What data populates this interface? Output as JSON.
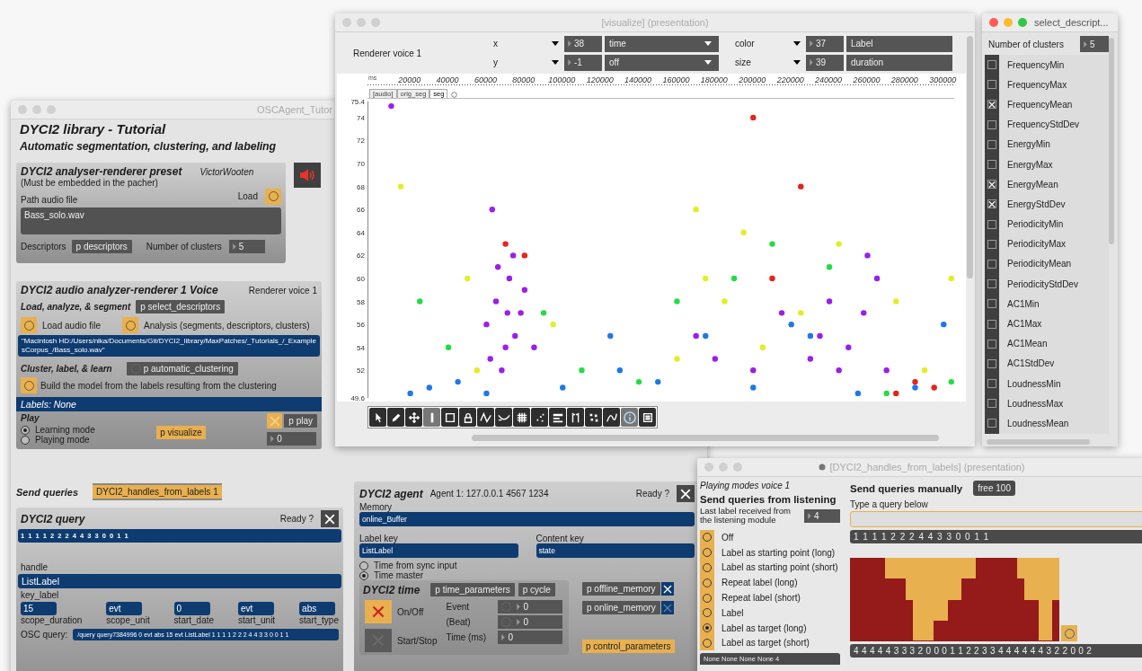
{
  "osc_window": {
    "title": "OSCAgent_Tutor",
    "heading": "DYCI2 library - Tutorial",
    "subheading": "Automatic segmentation, clustering, and labeling",
    "preset": {
      "title": "DYCI2 analyser-renderer preset",
      "name": "VictorWooten",
      "note": "(Must be embedded in the pacher)",
      "load_label": "Load",
      "path_label": "Path audio file",
      "path_value": "Bass_solo.wav",
      "descriptors_label": "Descriptors",
      "descriptors_button": "p descriptors",
      "clusters_label": "Number of clusters",
      "clusters_value": "5"
    },
    "voice": {
      "title": "DYCI2 audio analyzer-renderer 1 Voice",
      "renderer": "Renderer voice 1",
      "segment_label": "Load, analyze, & segment",
      "select_button": "p select_descriptors",
      "load_audio": "Load audio file",
      "analysis": "Analysis (segments, descriptors, clusters)",
      "path": "\"Macintosh HD:/Users/nika/Documents/Git/DYCI2_library/MaxPatches/_Tutorials_/_ExamplesCorpus_/Bass_solo.wav\"",
      "cluster_label": "Cluster, label, & learn",
      "clustering_button": "p automatic_clustering",
      "build_model": "Build the model from the labels resulting from the clustering",
      "labels": "Labels: None",
      "play_label": "Play",
      "modes": [
        {
          "label": "Learning mode",
          "selected": true
        },
        {
          "label": "Playing mode",
          "selected": false
        }
      ],
      "visualize_button": "p visualize",
      "play_toggle_on": false,
      "play_button": "p play",
      "play_value": "0"
    },
    "send_queries": {
      "label": "Send queries",
      "button": "DYCI2_handles_from_labels 1"
    },
    "query": {
      "title": "DYCI2 query",
      "ready": "Ready ?",
      "sequence": "1 1 1 1 2 2 2 4 4 3 3 0 0 1 1",
      "handle_label": "handle",
      "handle_value": "ListLabel",
      "key_label": "key_label",
      "params": [
        {
          "value": "15",
          "label": "scope_duration"
        },
        {
          "value": "evt",
          "label": "scope_unit"
        },
        {
          "value": "0",
          "label": "start_date"
        },
        {
          "value": "evt",
          "label": "start_unit"
        },
        {
          "value": "abs",
          "label": "start_type"
        }
      ],
      "osc_label": "OSC query:",
      "osc_value": "/query query7384996 0 evt abs 15 evt ListLabel 1 1 1 1 2 2 2 4 4 3 3 0 0 1 1"
    },
    "agent": {
      "title": "DYCI2 agent",
      "info": "Agent 1: 127.0.0.1 4567 1234",
      "ready": "Ready ?",
      "memory_label": "Memory",
      "memory_value": "online_Buffer",
      "label_key_label": "Label key",
      "label_key_value": "ListLabel",
      "content_key_label": "Content key",
      "content_key_value": "state",
      "time_modes": [
        {
          "label": "Time from sync input",
          "selected": false
        },
        {
          "label": "Time master",
          "selected": true
        }
      ],
      "time_title": "DYCI2 time",
      "time_params_button": "p time_parameters",
      "cycle_button": "p cycle",
      "toggles": [
        {
          "label": "On/Off",
          "checked": true
        },
        {
          "label": "Start/Stop",
          "checked": false
        }
      ],
      "counters": [
        {
          "label": "Event",
          "value": "0",
          "kind": "bang"
        },
        {
          "label": "(Beat)",
          "value": "0",
          "kind": "bang"
        },
        {
          "label": "Time (ms)",
          "value": "0",
          "kind": "plain"
        }
      ],
      "memories": [
        {
          "label": "p offline_memory",
          "checked": true
        },
        {
          "label": "p online_memory",
          "checked": false
        }
      ],
      "control_button": "p control_parameters"
    }
  },
  "visualize": {
    "title": "[visualize] (presentation)",
    "renderer": "Renderer voice 1",
    "mappings": [
      {
        "axis": "x",
        "number": "38",
        "field": "time"
      },
      {
        "axis": "y",
        "number": "-1",
        "field": "off"
      },
      {
        "axis": "color",
        "number": "37",
        "field": "Label"
      },
      {
        "axis": "size",
        "number": "39",
        "field": "duration"
      }
    ],
    "tabs": [
      {
        "label": "[audio]",
        "selected": false
      },
      {
        "label": "orig_seg",
        "selected": false
      },
      {
        "label": "seg",
        "selected": true
      }
    ],
    "chart_data": {
      "type": "scatter",
      "xlabel": "ms",
      "xlim": [
        -2000,
        306000
      ],
      "ylim": [
        49.6,
        75.4
      ],
      "xticks": [
        {
          "value": 20000,
          "label": "20000"
        },
        {
          "value": 40000,
          "label": "40000"
        },
        {
          "value": 60000,
          "label": "60000"
        },
        {
          "value": 80000,
          "label": "80000"
        },
        {
          "value": 100000,
          "label": "100000"
        },
        {
          "value": 120000,
          "label": "120000"
        },
        {
          "value": 140000,
          "label": "140000"
        },
        {
          "value": 160000,
          "label": "160000"
        },
        {
          "value": 180000,
          "label": "180000"
        },
        {
          "value": 200000,
          "label": "200000"
        },
        {
          "value": 220000,
          "label": "220000"
        },
        {
          "value": 240000,
          "label": "240000"
        },
        {
          "value": 260000,
          "label": "260000"
        },
        {
          "value": 280000,
          "label": "280000"
        },
        {
          "value": 300000,
          "label": "300000"
        }
      ],
      "yticks": [
        {
          "value": 75.4,
          "label": "75.4"
        },
        {
          "value": 74,
          "label": "74"
        },
        {
          "value": 72,
          "label": "72"
        },
        {
          "value": 70,
          "label": "70"
        },
        {
          "value": 68,
          "label": "68"
        },
        {
          "value": 66,
          "label": "66"
        },
        {
          "value": 64,
          "label": "64"
        },
        {
          "value": 62,
          "label": "62"
        },
        {
          "value": 60,
          "label": "60"
        },
        {
          "value": 58,
          "label": "58"
        },
        {
          "value": 56,
          "label": "56"
        },
        {
          "value": 54,
          "label": "54"
        },
        {
          "value": 52,
          "label": "52"
        },
        {
          "value": 49.6,
          "label": "49.6"
        }
      ],
      "series": [
        {
          "color": "#9b1fe8",
          "x": [
            60000,
            65000,
            70000,
            72000,
            75000,
            78000,
            68000,
            62000,
            80000,
            74000,
            85000,
            63000,
            235000,
            240000,
            250000,
            258000,
            265000,
            270000,
            230000,
            245000,
            180000,
            170000,
            215000,
            10000,
            260000,
            200000,
            66000,
            71000
          ],
          "values": [
            56,
            58,
            54,
            60,
            55,
            57,
            52,
            53,
            59,
            62,
            54,
            66,
            55,
            58,
            54,
            57,
            60,
            52,
            53,
            52,
            53,
            55,
            57,
            75,
            62,
            52,
            61,
            57
          ]
        },
        {
          "color": "#1e78e6",
          "x": [
            20000,
            30000,
            45000,
            60000,
            100000,
            130000,
            150000,
            175000,
            200000,
            230000,
            255000,
            285000,
            300000,
            125000,
            220000
          ],
          "values": [
            50,
            50.5,
            51,
            50,
            50.5,
            52,
            51,
            55,
            50.5,
            55,
            50,
            50.5,
            56,
            55,
            56
          ]
        },
        {
          "color": "#22dd44",
          "x": [
            25000,
            40000,
            90000,
            110000,
            160000,
            190000,
            210000,
            240000,
            270000,
            304000,
            140000
          ],
          "values": [
            58,
            54,
            57,
            52,
            58,
            60,
            63,
            61,
            50,
            51,
            51
          ]
        },
        {
          "color": "#e2ee22",
          "x": [
            15000,
            50000,
            55000,
            95000,
            170000,
            175000,
            185000,
            195000,
            205000,
            225000,
            245000,
            275000,
            290000,
            304000,
            160000
          ],
          "values": [
            68,
            60,
            52,
            56,
            66,
            60,
            58,
            64,
            54,
            57,
            63,
            58,
            52,
            60,
            53
          ]
        },
        {
          "color": "#e6231c",
          "x": [
            70000,
            80000,
            210000,
            225000,
            275000,
            285000,
            295000,
            200000
          ],
          "values": [
            63,
            62,
            60,
            68,
            50,
            51,
            50.5,
            74
          ]
        }
      ]
    }
  },
  "descriptors": {
    "title": "select_descript...",
    "clusters_label": "Number of clusters",
    "clusters_value": "5",
    "items": [
      {
        "label": "FrequencyMin",
        "checked": false
      },
      {
        "label": "FrequencyMax",
        "checked": false
      },
      {
        "label": "FrequencyMean",
        "checked": true
      },
      {
        "label": "FrequencyStdDev",
        "checked": false
      },
      {
        "label": "EnergyMin",
        "checked": false
      },
      {
        "label": "EnergyMax",
        "checked": false
      },
      {
        "label": "EnergyMean",
        "checked": true
      },
      {
        "label": "EnergyStdDev",
        "checked": true
      },
      {
        "label": "PeriodicityMin",
        "checked": false
      },
      {
        "label": "PeriodicityMax",
        "checked": false
      },
      {
        "label": "PeriodicityMean",
        "checked": false
      },
      {
        "label": "PeriodicityStdDev",
        "checked": false
      },
      {
        "label": "AC1Min",
        "checked": false
      },
      {
        "label": "AC1Max",
        "checked": false
      },
      {
        "label": "AC1Mean",
        "checked": false
      },
      {
        "label": "AC1StdDev",
        "checked": false
      },
      {
        "label": "LoudnessMin",
        "checked": false
      },
      {
        "label": "LoudnessMax",
        "checked": false
      },
      {
        "label": "LoudnessMean",
        "checked": false
      }
    ]
  },
  "handles": {
    "title": "[DYCI2_handles_from_labels] (presentation)",
    "mode_title": "Playing modes voice 1",
    "listen_title": "Send queries from  listening",
    "manual_title": "Send queries manually",
    "free_button": "free 100",
    "last_label": "Last label received from the listening module",
    "last_value": "4",
    "modes": [
      {
        "label": "Off",
        "selected": false
      },
      {
        "label": "Label as starting point (long)",
        "selected": false
      },
      {
        "label": "Label as starting point (short)",
        "selected": false
      },
      {
        "label": "Repeat label (long)",
        "selected": false
      },
      {
        "label": "Repeat label (short)",
        "selected": false
      },
      {
        "label": "Label",
        "selected": false
      },
      {
        "label": "Label as target (long)",
        "selected": true
      },
      {
        "label": "Label as target (short)",
        "selected": false
      }
    ],
    "history": "None None None None 4",
    "query_label": "Type a query below",
    "query_sequence": "1 1 1 1 2 2 2 4 4 3 3 0 0 1 1",
    "bars": [
      {
        "level": 1
      },
      {
        "level": 1
      },
      {
        "level": 1
      },
      {
        "level": 1
      },
      {
        "level": 1
      },
      {
        "level": 0.75
      },
      {
        "level": 0.75
      },
      {
        "level": 0.75
      },
      {
        "level": 0.5
      },
      {
        "level": 0
      },
      {
        "level": 0
      },
      {
        "level": 0
      },
      {
        "level": 0.25
      },
      {
        "level": 0.25
      },
      {
        "level": 0.5
      },
      {
        "level": 0.5
      },
      {
        "level": 0.75
      },
      {
        "level": 0.75
      },
      {
        "level": 1
      },
      {
        "level": 1
      },
      {
        "level": 1
      },
      {
        "level": 1
      },
      {
        "level": 1
      },
      {
        "level": 1
      },
      {
        "level": 0.75
      },
      {
        "level": 0.5
      },
      {
        "level": 0.5
      },
      {
        "level": 0
      },
      {
        "level": 0
      },
      {
        "level": 0.5
      }
    ],
    "output": "4 4 4 4 4 3 3 3 2 0 0 0 1 1 2 2 3 3 4 4 4 4 4 4 3 2 2 0 0 2"
  }
}
